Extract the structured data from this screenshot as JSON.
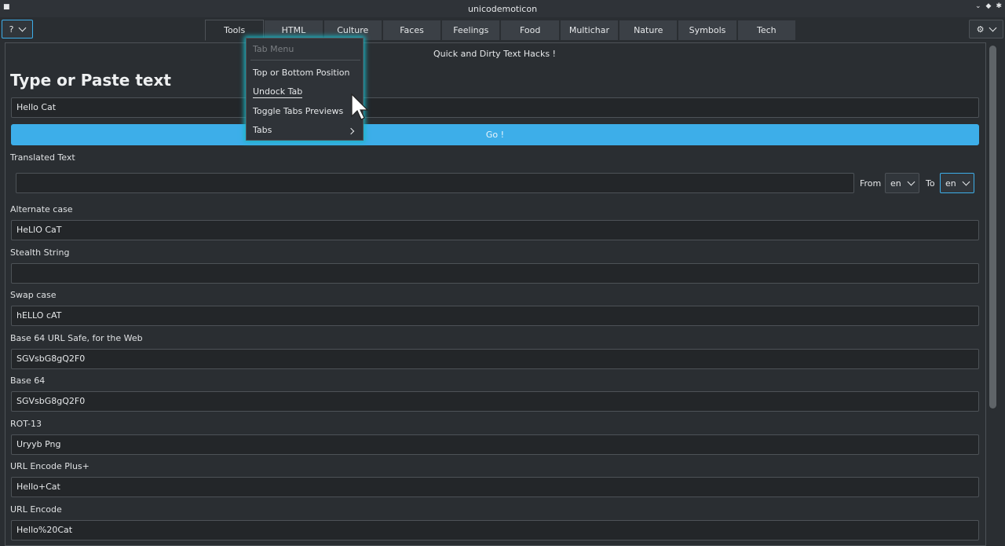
{
  "window": {
    "title": "unicodemoticon"
  },
  "toolbar": {
    "help_label": "?",
    "settings_icon": "gear-icon"
  },
  "tabs": [
    {
      "label": "Tools",
      "active": true
    },
    {
      "label": "HTML"
    },
    {
      "label": "Culture"
    },
    {
      "label": "Faces"
    },
    {
      "label": "Feelings"
    },
    {
      "label": "Food"
    },
    {
      "label": "Multichar"
    },
    {
      "label": "Nature"
    },
    {
      "label": "Symbols"
    },
    {
      "label": "Tech"
    }
  ],
  "main": {
    "subtitle": "Quick and Dirty Text Hacks !",
    "heading": "Type or Paste text",
    "input_value": "Hello Cat",
    "go_label": "Go !",
    "translated_label": "Translated Text",
    "translated_value": "",
    "from_label": "From",
    "from_value": "en",
    "to_label": "To",
    "to_value": "en",
    "outputs": [
      {
        "label": "Alternate case",
        "value": "HeLlO CaT"
      },
      {
        "label": "Stealth String",
        "value": ""
      },
      {
        "label": "Swap case",
        "value": "hELLO cAT"
      },
      {
        "label": "Base 64 URL Safe, for the Web",
        "value": "SGVsbG8gQ2F0"
      },
      {
        "label": "Base 64",
        "value": "SGVsbG8gQ2F0"
      },
      {
        "label": "ROT-13",
        "value": "Uryyb Png"
      },
      {
        "label": "URL Encode Plus+",
        "value": "Hello+Cat"
      },
      {
        "label": "URL Encode",
        "value": "Hello%20Cat"
      }
    ]
  },
  "context_menu": {
    "title": "Tab Menu",
    "items": [
      "Top or Bottom Position",
      "Undock Tab",
      "Toggle Tabs Previews",
      "Tabs"
    ]
  },
  "colors": {
    "accent": "#3daee9",
    "menu_glow": "#1bb5c4",
    "background": "#2a2e32"
  }
}
